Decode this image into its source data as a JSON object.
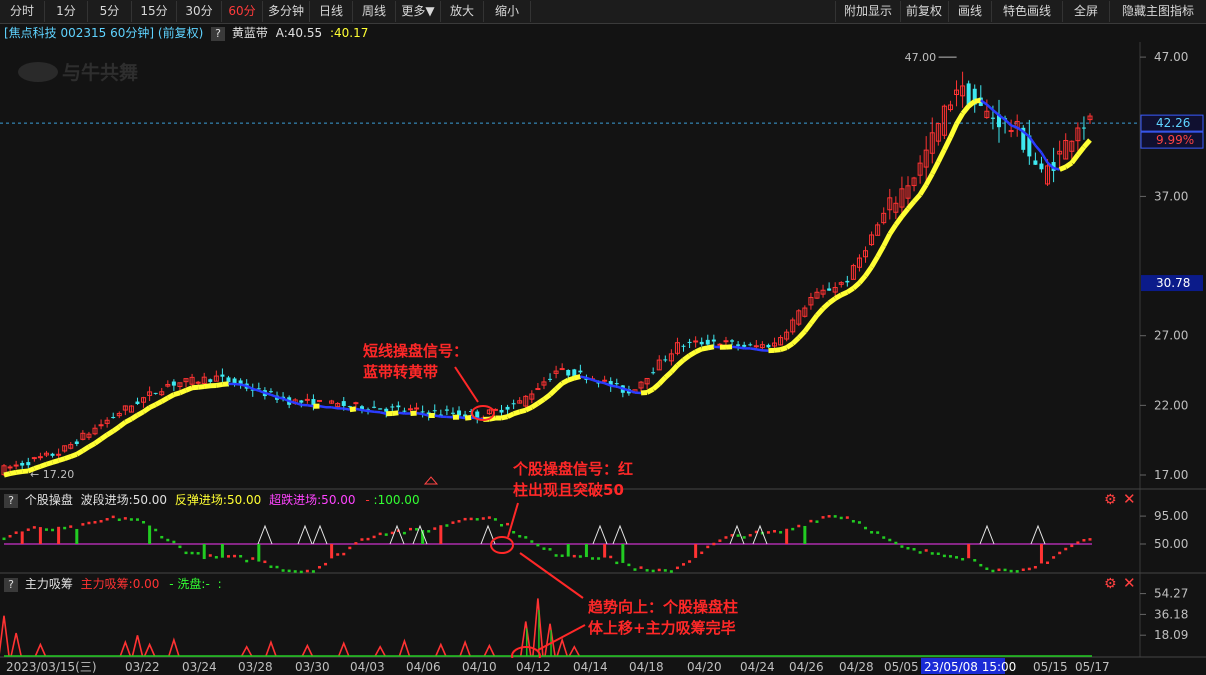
{
  "toolbar": {
    "left": [
      "分时",
      "1分",
      "5分",
      "15分",
      "30分",
      "60分",
      "多分钟",
      "日线",
      "周线",
      "更多▼",
      "放大",
      "缩小"
    ],
    "active": "60分",
    "right": [
      "附加显示",
      "前复权",
      "画线",
      "特色画线",
      "全屏",
      "隐藏主图指标"
    ]
  },
  "info": {
    "stock": "[焦点科技 002315 60分钟] (前复权)",
    "help": "?",
    "indicator": "黄蓝带",
    "a_label": "A:40.55",
    "b_label": ":40.17"
  },
  "watermark": "与牛共舞",
  "price_axis": {
    "ticks": [
      "47.00",
      "37.00",
      "27.00",
      "22.00",
      "17.00"
    ],
    "hidden_tick": "32.00",
    "current_price": "42.26",
    "current_pct": "9.99%",
    "cursor_price": "30.78",
    "high_label": "47.00",
    "low_label": "17.20"
  },
  "sub1": {
    "help": "?",
    "name": "个股操盘",
    "l1": "波段进场:50.00",
    "l2": "反弹进场:50.00",
    "l3": "超跌进场:50.00",
    "l4": "-",
    "l5": ":100.00",
    "ticks": [
      "95.00",
      "50.00"
    ]
  },
  "sub2": {
    "help": "?",
    "name": "主力吸筹",
    "l1": "主力吸筹:0.00",
    "l2": "- 洗盘:-",
    "l3": ":",
    "ticks": [
      "54.27",
      "36.18",
      "18.09"
    ]
  },
  "annotations": {
    "a1_line1": "短线操盘信号：",
    "a1_line2": "蓝带转黄带",
    "a2_line1": "个股操盘信号：红",
    "a2_line2": "柱出现且突破50",
    "a3_line1": "趋势向上：个股操盘柱",
    "a3_line2": "体上移+主力吸筹完毕"
  },
  "dates": [
    "2023/03/15(三)",
    "03/22",
    "03/24",
    "03/28",
    "03/30",
    "04/03",
    "04/06",
    "04/10",
    "04/12",
    "04/14",
    "04/18",
    "04/20",
    "04/24",
    "04/26",
    "04/28",
    "05/05",
    "23/05/08 15:00",
    "05/15",
    "05/17"
  ],
  "colors": {
    "up": "#ff3333",
    "down": "#3ee8f0",
    "yellow_band": "#ffff33",
    "blue_band": "#2a3cff",
    "green": "#22cc22",
    "magenta": "#cc33cc",
    "annotation": "#ff2828"
  }
}
